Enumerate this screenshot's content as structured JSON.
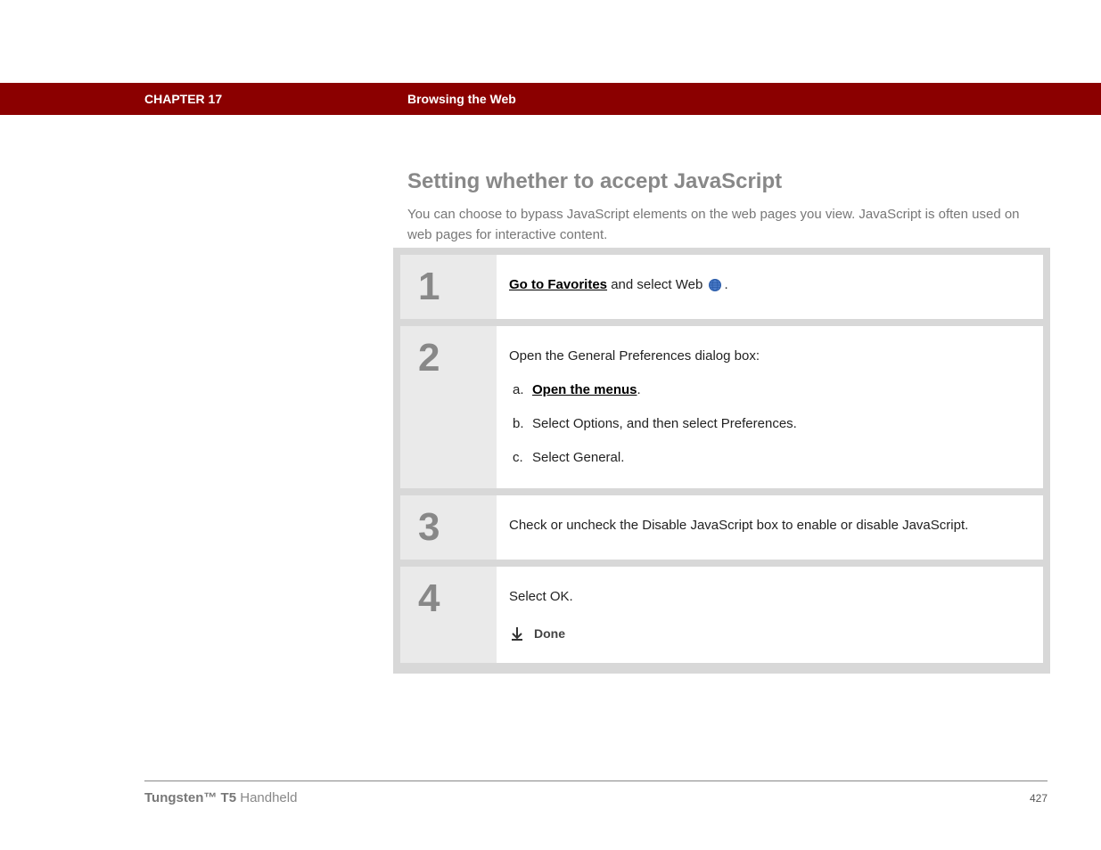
{
  "header": {
    "chapter": "CHAPTER 17",
    "breadcrumb": "Browsing the Web"
  },
  "section": {
    "title": "Setting whether to accept JavaScript",
    "intro": "You can choose to bypass JavaScript elements on the web pages you view. JavaScript is often used on web pages for interactive content."
  },
  "steps": [
    {
      "number": "1",
      "link_text": "Go to Favorites",
      "after_link": " and select Web ",
      "tail": "."
    },
    {
      "number": "2",
      "lead": "Open the General Preferences dialog box:",
      "items": [
        {
          "letter": "a.",
          "link": "Open the menus",
          "tail": "."
        },
        {
          "letter": "b.",
          "text": "Select Options, and then select Preferences."
        },
        {
          "letter": "c.",
          "text": "Select General."
        }
      ]
    },
    {
      "number": "3",
      "text": "Check or uncheck the Disable JavaScript box to enable or disable JavaScript."
    },
    {
      "number": "4",
      "text": "Select OK.",
      "done_label": "Done"
    }
  ],
  "footer": {
    "product_bold": "Tungsten™ T5",
    "product_tail": " Handheld",
    "page_number": "427"
  }
}
